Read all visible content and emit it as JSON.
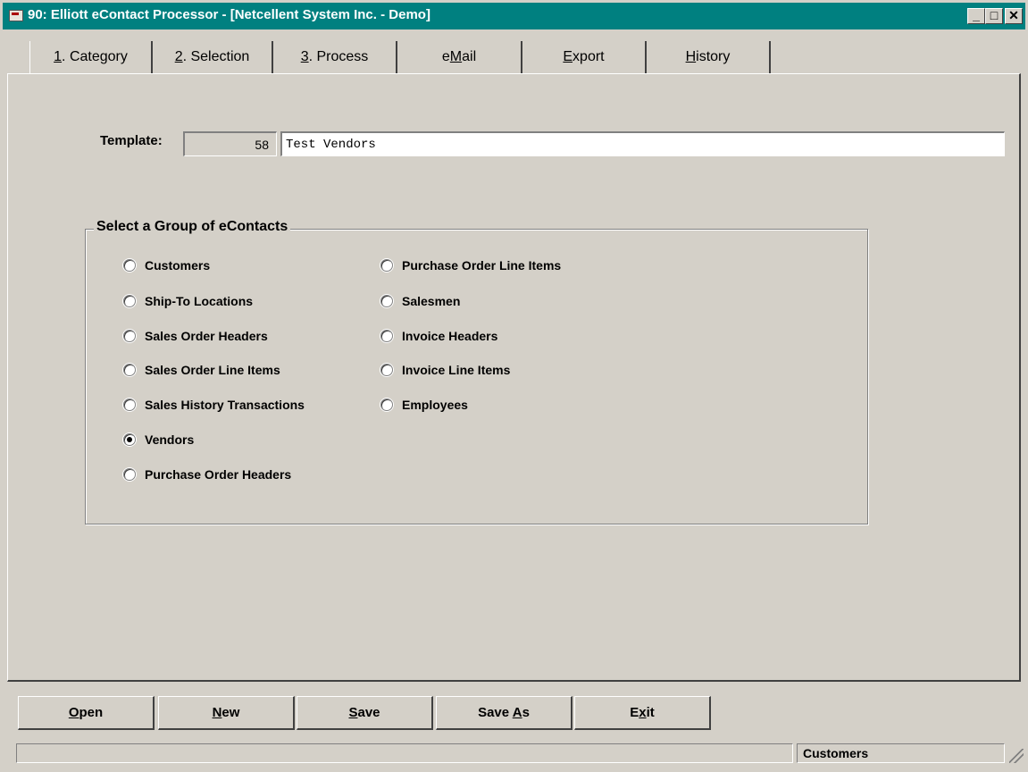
{
  "window": {
    "title": "90: Elliott eContact Processor - [Netcellent System Inc. - Demo]",
    "controls": {
      "minimize": "_",
      "maximize": "□",
      "close": "✕"
    }
  },
  "tabs": [
    {
      "key": "1",
      "rest": ". Category"
    },
    {
      "key": "2",
      "rest": ". Selection"
    },
    {
      "key": "3",
      "rest": ". Process"
    },
    {
      "pre": "e",
      "key": "M",
      "rest": "ail"
    },
    {
      "pre": "",
      "key": "E",
      "rest": "xport"
    },
    {
      "pre": "",
      "key": "H",
      "rest": "istory"
    }
  ],
  "template": {
    "label": "Template:",
    "number": "58",
    "name": "Test Vendors"
  },
  "group": {
    "title": "Select a Group of eContacts",
    "options": [
      "Customers",
      "Ship-To Locations",
      "Sales Order Headers",
      "Sales Order Line Items",
      "Sales History Transactions",
      "Vendors",
      "Purchase Order Headers",
      "Purchase Order Line Items",
      "Salesmen",
      "Invoice Headers",
      "Invoice Line Items",
      "Employees"
    ],
    "selected": "Vendors"
  },
  "buttons": [
    {
      "key": "O",
      "rest": "pen"
    },
    {
      "key": "N",
      "rest": "ew"
    },
    {
      "key": "S",
      "rest": "ave"
    },
    {
      "pre": "Save ",
      "key": "A",
      "rest": "s"
    },
    {
      "pre": "E",
      "key": "x",
      "rest": "it"
    }
  ],
  "status": {
    "left": "",
    "right": "Customers"
  }
}
